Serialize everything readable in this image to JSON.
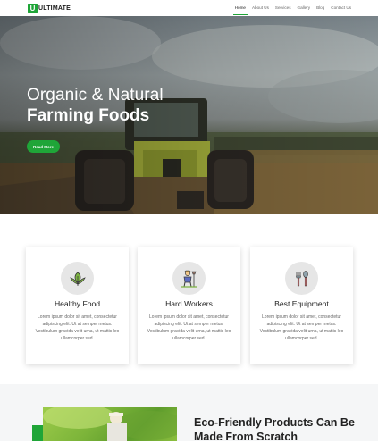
{
  "logo": {
    "mark": "U",
    "text": "ULTIMATE"
  },
  "nav": {
    "items": [
      {
        "label": "Home",
        "active": true
      },
      {
        "label": "About Us",
        "active": false
      },
      {
        "label": "Services",
        "active": false
      },
      {
        "label": "Gallery",
        "active": false
      },
      {
        "label": "Blog",
        "active": false
      },
      {
        "label": "Contact Us",
        "active": false
      }
    ]
  },
  "hero": {
    "eyebrow": "",
    "title_line1": "Organic & Natural",
    "title_line2": "Farming Foods",
    "button_label": "Read More"
  },
  "features": [
    {
      "icon": "plant-icon",
      "title": "Healthy Food",
      "text": "Lorem ipsum dolor sit amet, consectetur adipiscing elit. Ut at semper metus. Vestibulum gravida velit urna, ut mattis leo ullamcorper sed."
    },
    {
      "icon": "farmer-icon",
      "title": "Hard Workers",
      "text": "Lorem ipsum dolor sit amet, consectetur adipiscing elit. Ut at semper metus. Vestibulum gravida velit urna, ut mattis leo ullamcorper sed."
    },
    {
      "icon": "fork-spoon-icon",
      "title": "Best Equipment",
      "text": "Lorem ipsum dolor sit amet, consectetur adipiscing elit. Ut at semper metus. Vestibulum gravida velit urna, ut mattis leo ullamcorper sed."
    }
  ],
  "section2": {
    "title_line1": "Eco-Friendly Products Can Be",
    "title_line2": "Made From Scratch"
  },
  "colors": {
    "accent": "#1fa538",
    "text_dark": "#222222",
    "text_muted": "#666666"
  }
}
